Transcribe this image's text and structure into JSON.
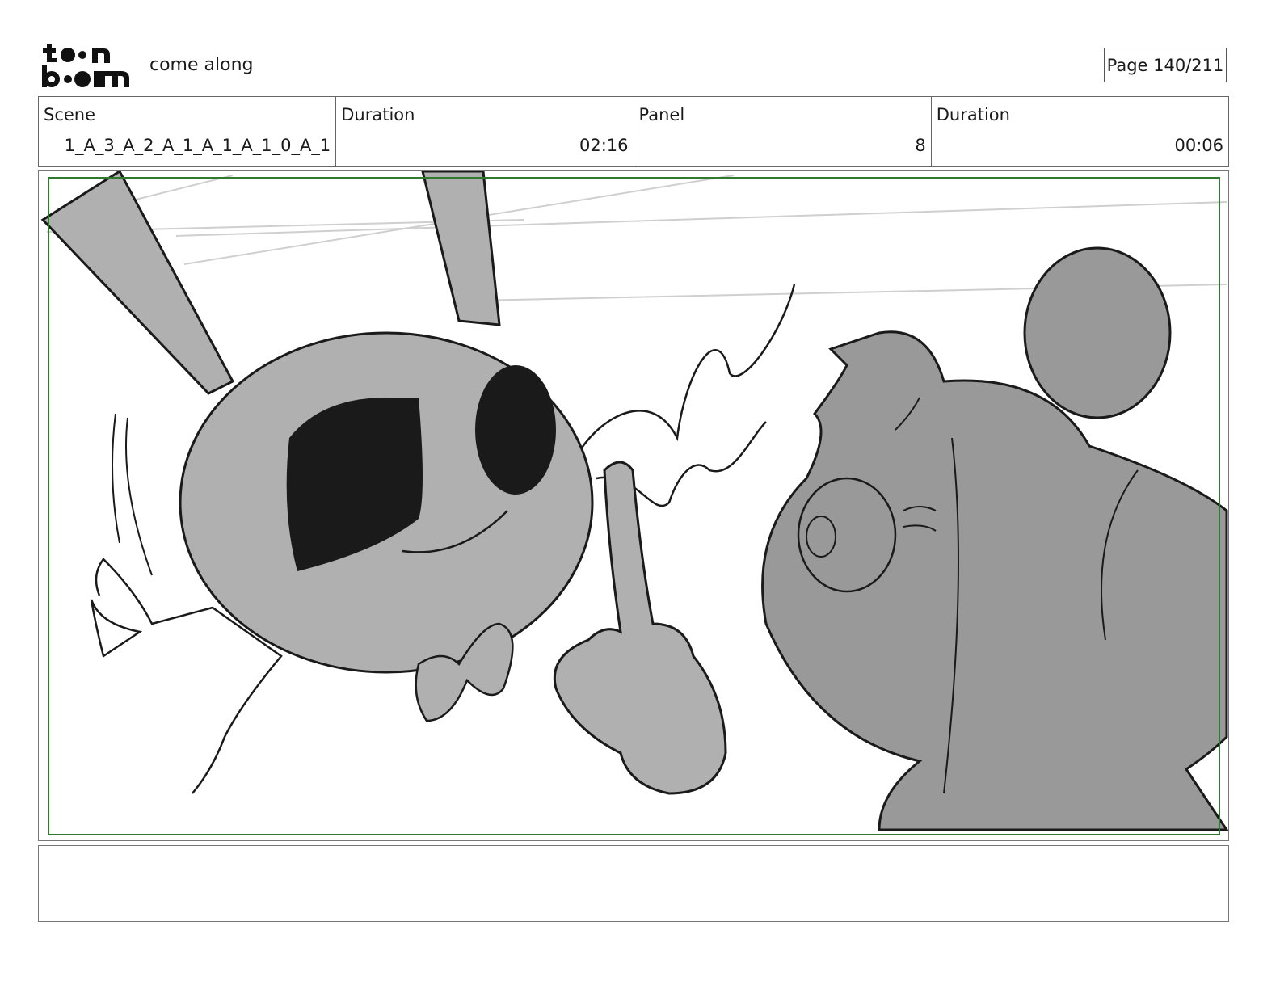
{
  "header": {
    "logo_text": "toon boom",
    "project_title": "come along",
    "page_indicator": "Page 140/211"
  },
  "info": {
    "scene_label": "Scene",
    "scene_value": "1_A_3_A_2_A_1_A_1_A_1_0_A_1",
    "scene_duration_label": "Duration",
    "scene_duration_value": "02:16",
    "panel_label": "Panel",
    "panel_value": "8",
    "panel_duration_label": "Duration",
    "panel_duration_value": "00:06"
  },
  "colors": {
    "safe_frame": "#2f7a2f",
    "light_gray": "#b0b0b0",
    "dark_gray": "#999999",
    "ink": "#1a1a1a"
  },
  "notes": {
    "text": ""
  }
}
